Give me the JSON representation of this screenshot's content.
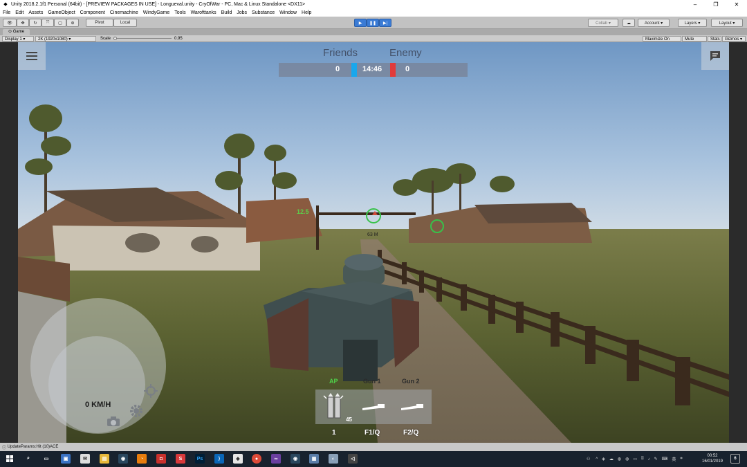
{
  "window": {
    "title": "Unity 2018.2.1f1 Personal (64bit) - [PREVIEW PACKAGES IN USE] - Longueval.unity - CryOfWar - PC, Mac & Linux Standalone <DX11>",
    "controls": {
      "minimize": "–",
      "maximize": "❐",
      "close": "✕"
    }
  },
  "menubar": {
    "items": [
      "File",
      "Edit",
      "Assets",
      "GameObject",
      "Component",
      "Cinemachine",
      "WindyGame",
      "Tools",
      "Warofttanks",
      "Build",
      "Jobs",
      "Substance",
      "Window",
      "Help"
    ]
  },
  "toolbar": {
    "pivot_label": "Pivot",
    "local_label": "Local",
    "collab_label": "Collab ▾",
    "account_label": "Account ▾",
    "layers_label": "Layers ▾",
    "layout_label": "Layout ▾"
  },
  "game_view": {
    "tab_label": "Game",
    "display_label": "Display 1",
    "resolution_label": "2K (1920x1080)",
    "scale_label": "Scale",
    "scale_value": "0.95",
    "maximize_label": "Maximize On Play",
    "mute_label": "Mute Audio",
    "stats_label": "Stats",
    "gizmos_label": "Gizmos ▾"
  },
  "hud": {
    "friends_label": "Friends",
    "enemy_label": "Enemy",
    "friends_score": "0",
    "enemy_score": "0",
    "timer": "14:46",
    "range_label": "63 M",
    "side_marker": "12.5",
    "speed_label": "0 KM/H",
    "ammo": {
      "ap_label": "AP",
      "gun1_label": "Gun 1",
      "gun2_label": "Gun 2",
      "ap_count": "45",
      "slot1_key": "1",
      "slot2_key": "F1/Q",
      "slot3_key": "F2/Q"
    },
    "colors": {
      "friend": "#19a7ec",
      "enemy": "#e23b3b",
      "reticle": "#38c24a"
    }
  },
  "statusbar": {
    "message": "UpdateParams:Hit (10)ACE"
  },
  "taskbar": {
    "clock_time": "00:52",
    "clock_date": "16/01/2019",
    "tray_lang": "英",
    "notification_count": "6"
  }
}
